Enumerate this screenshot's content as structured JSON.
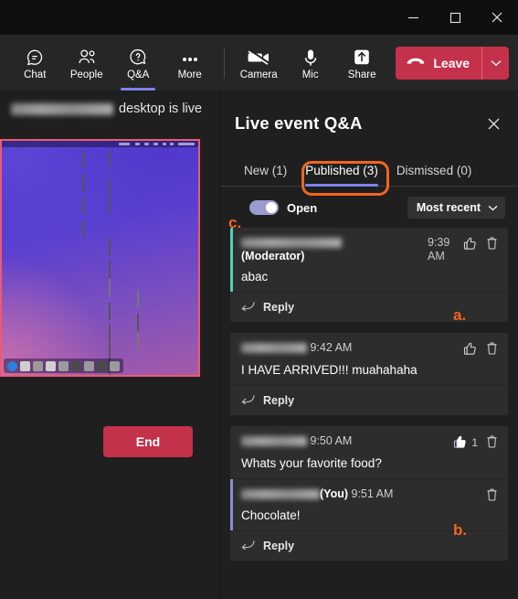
{
  "window": {
    "minimize_label": "Minimize",
    "maximize_label": "Maximize",
    "close_label": "Close"
  },
  "toolbar": {
    "items": [
      {
        "label": "Chat",
        "icon": "chat-icon",
        "active": false
      },
      {
        "label": "People",
        "icon": "people-icon",
        "active": false
      },
      {
        "label": "Q&A",
        "icon": "qa-icon",
        "active": true
      },
      {
        "label": "More",
        "icon": "ellipsis-icon",
        "active": false
      },
      {
        "label": "Camera",
        "icon": "camera-off-icon",
        "active": false
      },
      {
        "label": "Mic",
        "icon": "microphone-icon",
        "active": false
      },
      {
        "label": "Share",
        "icon": "share-screen-icon",
        "active": false
      }
    ],
    "leave_label": "Leave",
    "leave_color": "#c4314b"
  },
  "stage": {
    "live_presenter_name": "",
    "live_status_text": "desktop is live",
    "end_button_label": "End",
    "preview_border_color": "#ec5a72"
  },
  "qa": {
    "title": "Live event Q&A",
    "close_label": "Close",
    "tabs": [
      {
        "label": "New (1)",
        "selected": false
      },
      {
        "label": "Published (3)",
        "selected": true
      },
      {
        "label": "Dismissed (0)",
        "selected": false
      }
    ],
    "toggle_label": "Open",
    "toggle_on": true,
    "toggle_color": "#9b9bd0",
    "sort_label": "Most recent",
    "reply_label": "Reply",
    "messages": [
      {
        "author": "",
        "author_suffix": "(Moderator)",
        "suffix_on_new_line": true,
        "time": "9:39 AM",
        "time_wrapped": true,
        "text": "abac",
        "accent": "teal",
        "like_count": "",
        "liked": false,
        "has_like_button": true,
        "has_delete_button": true,
        "has_reply": true
      },
      {
        "author": "",
        "author_suffix": "",
        "suffix_on_new_line": false,
        "time": "9:42 AM",
        "time_wrapped": false,
        "text": "I HAVE ARRIVED!!! muahahaha",
        "accent": "none",
        "like_count": "",
        "liked": false,
        "has_like_button": true,
        "has_delete_button": true,
        "has_reply": true
      },
      {
        "author": "",
        "author_suffix": "",
        "suffix_on_new_line": false,
        "time": "9:50 AM",
        "time_wrapped": false,
        "text": "Whats your favorite food?",
        "accent": "none",
        "like_count": "1",
        "liked": true,
        "has_like_button": true,
        "has_delete_button": true,
        "has_reply": false
      },
      {
        "author": "",
        "author_suffix": "(You)",
        "suffix_on_new_line": false,
        "time": "9:51 AM",
        "time_wrapped": false,
        "text": "Chocolate!",
        "accent": "purple",
        "like_count": "",
        "liked": false,
        "has_like_button": false,
        "has_delete_button": true,
        "has_reply": true
      }
    ]
  },
  "annotations": {
    "color": "#f0661f",
    "a": "a.",
    "b": "b.",
    "c": "c.",
    "highlight_target": "Published (3)"
  }
}
